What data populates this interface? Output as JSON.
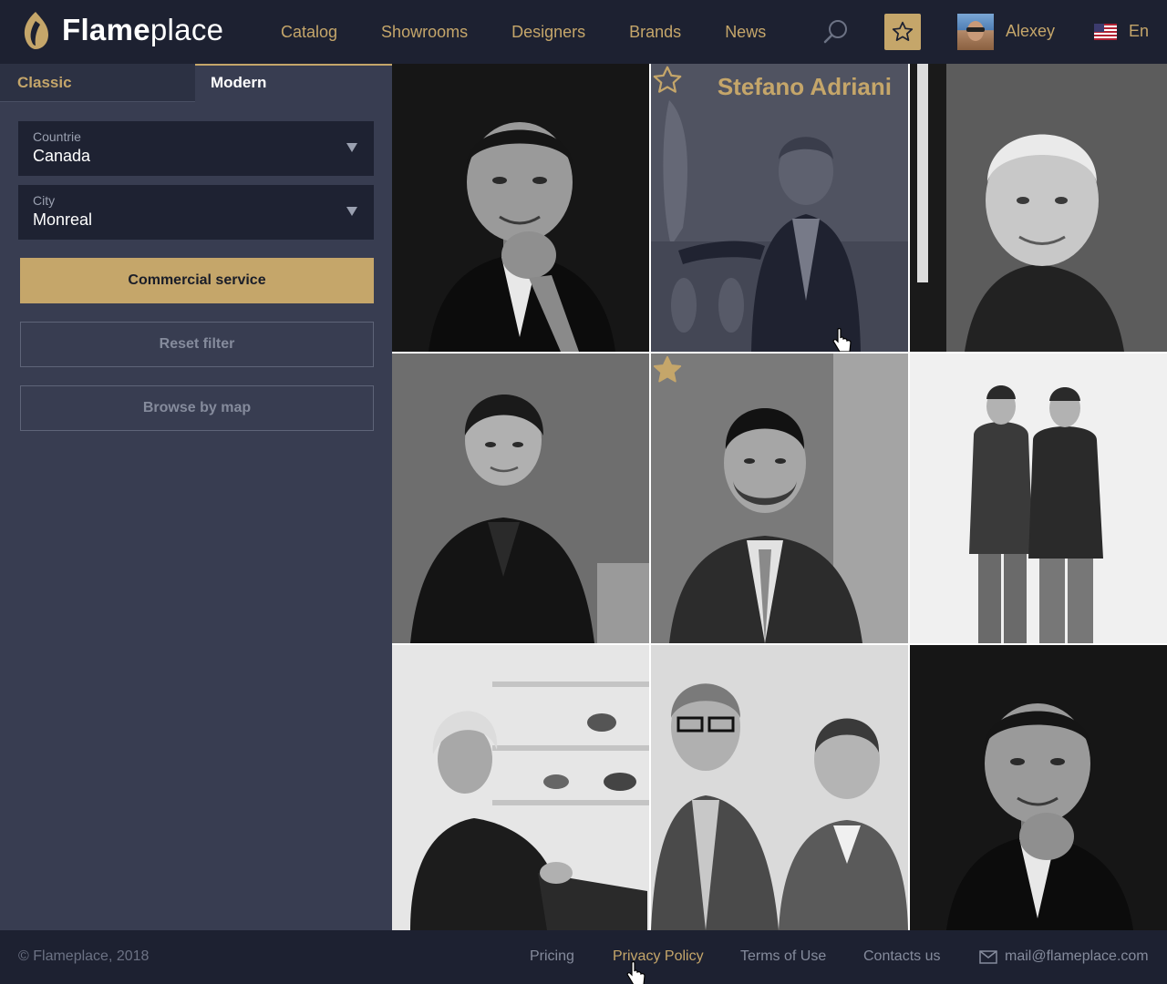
{
  "header": {
    "logo_bold": "Flame",
    "logo_light": "place",
    "nav": [
      "Catalog",
      "Showrooms",
      "Designers",
      "Brands",
      "News"
    ],
    "user_name": "Alexey",
    "language": "En"
  },
  "sidebar": {
    "tabs": {
      "classic": "Classic",
      "modern": "Modern",
      "active": "modern"
    },
    "country": {
      "label": "Countrie",
      "value": "Canada"
    },
    "city": {
      "label": "City",
      "value": "Monreal"
    },
    "commercial_label": "Commercial service",
    "reset_label": "Reset filter",
    "map_label": "Browse by map"
  },
  "grid": {
    "hovered_designer_name": "Stefano Adriani",
    "tiles": [
      {
        "favorite": false,
        "hovered": false
      },
      {
        "favorite": false,
        "hovered": true
      },
      {
        "favorite": false,
        "hovered": false
      },
      {
        "favorite": false,
        "hovered": false
      },
      {
        "favorite": true,
        "hovered": false
      },
      {
        "favorite": false,
        "hovered": false
      },
      {
        "favorite": false,
        "hovered": false
      },
      {
        "favorite": false,
        "hovered": false
      },
      {
        "favorite": false,
        "hovered": false
      }
    ]
  },
  "footer": {
    "copyright": "© Flameplace, 2018",
    "links": [
      "Pricing",
      "Privacy Policy",
      "Terms of Use",
      "Contacts us"
    ],
    "email": "mail@flameplace.com"
  },
  "colors": {
    "accent": "#c5a66a",
    "header_bg": "#1d2131",
    "sidebar_bg": "#383d51",
    "field_bg": "#1e2232"
  }
}
